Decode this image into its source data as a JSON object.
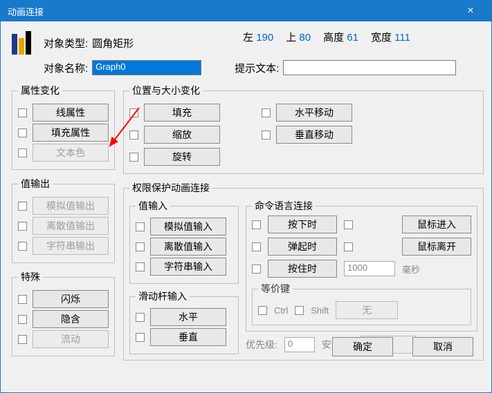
{
  "title": "动画连接",
  "header": {
    "objTypeLabel": "对象类型:",
    "objType": "圆角矩形",
    "objNameLabel": "对象名称:",
    "objName": "Graph0",
    "hintLabel": "提示文本:",
    "hintValue": "",
    "leftL": "左",
    "leftV": "190",
    "topL": "上",
    "topV": "80",
    "heightL": "高度",
    "heightV": "61",
    "widthL": "宽度",
    "widthV": "111"
  },
  "groups": {
    "attr": "属性变化",
    "pos": "位置与大小变化",
    "valout": "值输出",
    "protect": "权限保护动画连接",
    "valin": "值输入",
    "cmd": "命令语言连接",
    "slider": "滑动杆输入",
    "special": "特殊",
    "eq": "等价键"
  },
  "btns": {
    "line": "线属性",
    "fill": "填充属性",
    "textcolor": "文本色",
    "fillp": "填充",
    "scale": "缩放",
    "rotate": "旋转",
    "hmove": "水平移动",
    "vmove": "垂直移动",
    "aout": "模拟值输出",
    "dout": "离散值输出",
    "sout": "字符串输出",
    "ain": "模拟值输入",
    "din": "离散值输入",
    "sin": "字符串输入",
    "press": "按下时",
    "release": "弹起时",
    "hold": "按住时",
    "menter": "鼠标进入",
    "mleave": "鼠标离开",
    "horiz": "水平",
    "vert": "垂直",
    "blink": "闪烁",
    "hide": "隐含",
    "flow": "流动",
    "ok": "确定",
    "cancel": "取消"
  },
  "cmd": {
    "ms": "1000",
    "msUnit": "毫秒"
  },
  "eq": {
    "ctrl": "Ctrl",
    "shift": "Shift",
    "none": "无"
  },
  "bottom": {
    "priL": "优先级:",
    "priV": "0",
    "secL": "安全区:",
    "secBtn": "..."
  }
}
